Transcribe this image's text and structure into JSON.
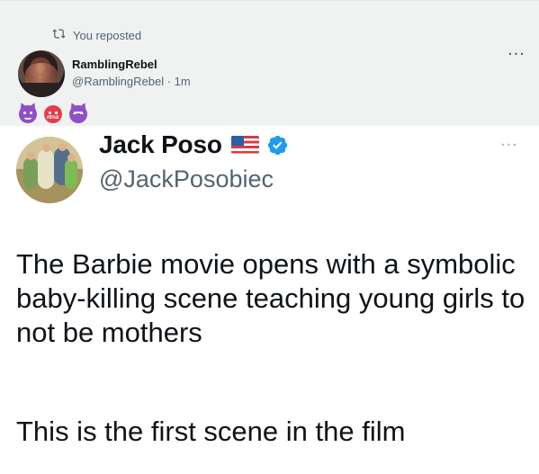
{
  "repost": {
    "label": "You reposted",
    "icon": "repost-icon",
    "user": {
      "name": "RamblingRebel",
      "handle": "@RamblingRebel",
      "time": "1m"
    },
    "more_label": "...",
    "emojis": [
      "smiling-devil-emoji",
      "angry-symbol-emoji",
      "angry-devil-emoji"
    ]
  },
  "tweet": {
    "author": {
      "name": "Jack Poso",
      "handle": "@JackPosobiec",
      "flag": "🇺🇸",
      "verified_icon": "verified-badge-icon"
    },
    "more_label": "...",
    "paragraphs": [
      "The Barbie movie opens with a symbolic baby-killing scene teaching young girls to not be mothers",
      "This is the first scene in the film"
    ]
  },
  "colors": {
    "repost_background": "#f0f1f1",
    "secondary_text": "#536471",
    "verified_blue": "#1d9bf0",
    "text": "#0f1419"
  }
}
